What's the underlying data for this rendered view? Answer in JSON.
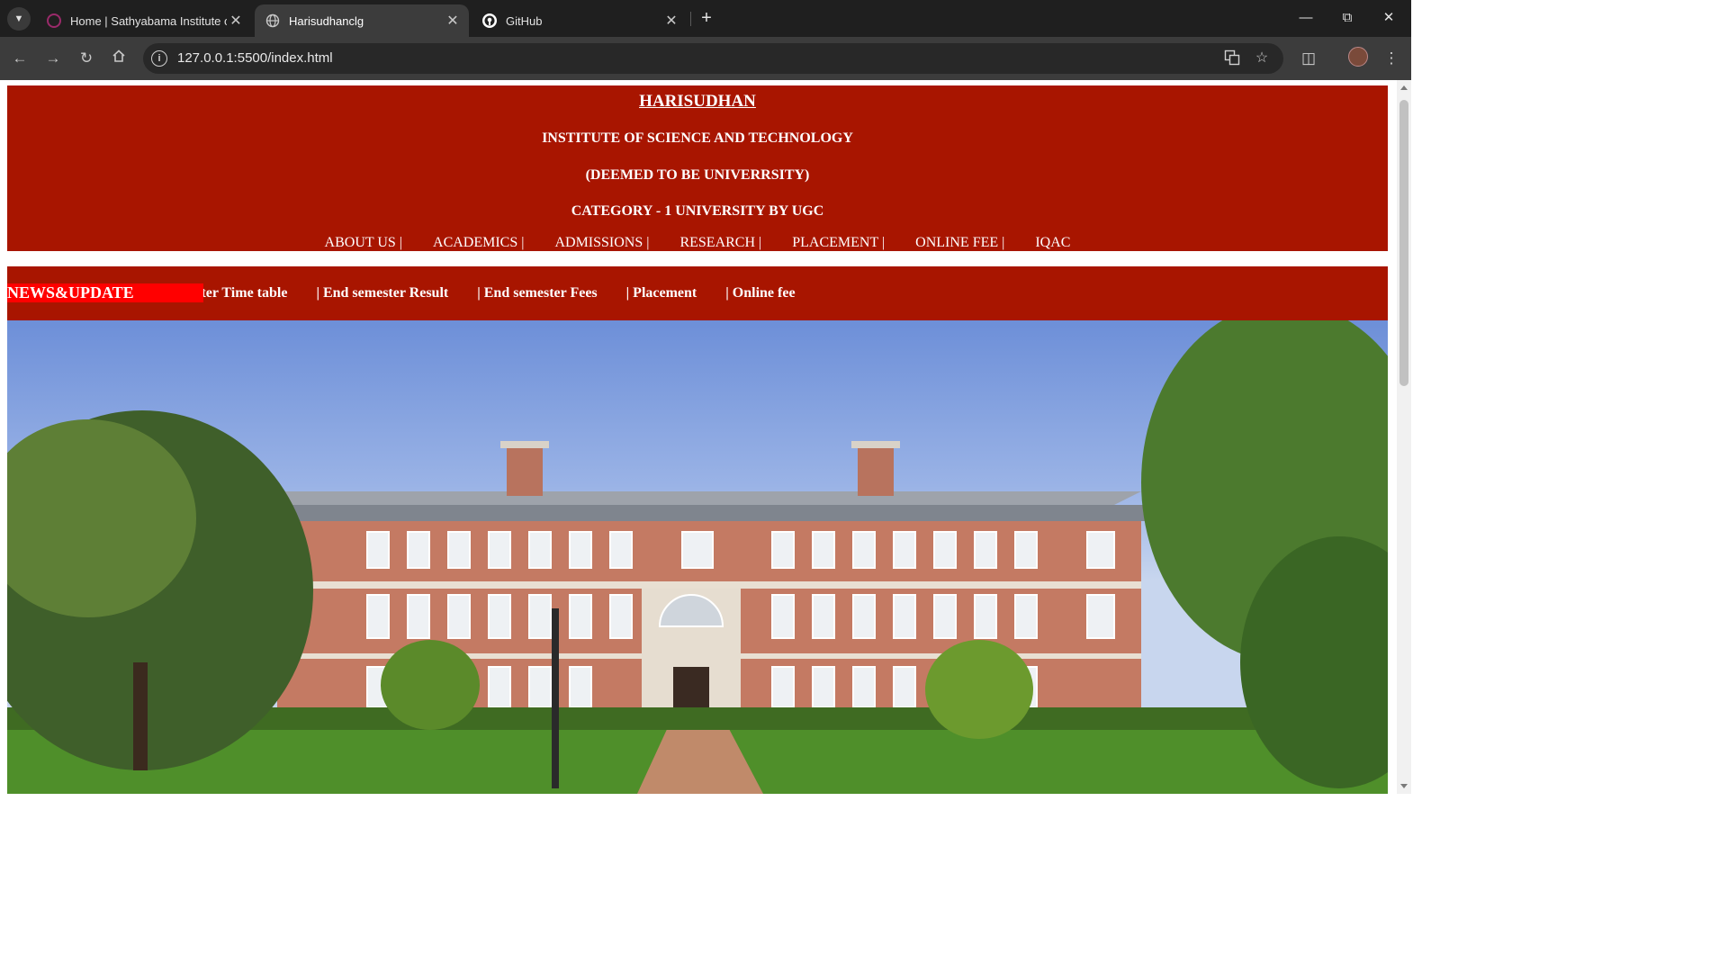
{
  "browser": {
    "tabs": [
      {
        "title": "Home | Sathyabama Institute of",
        "favicon": "sathyabama-favicon",
        "active": false
      },
      {
        "title": "Harisudhanclg",
        "favicon": "globe-icon",
        "active": true
      },
      {
        "title": "GitHub",
        "favicon": "github-icon",
        "active": false
      }
    ],
    "url": "127.0.0.1:5500/index.html"
  },
  "page": {
    "header": {
      "name": "HARISUDHAN",
      "line1": "INSTITUTE OF SCIENCE AND TECHNOLOGY",
      "line2": "(DEEMED TO BE UNIVERRSITY)",
      "line3": "CATEGORY - 1 UNIVERSITY BY UGC"
    },
    "nav": {
      "about": "ABOUT US |",
      "academics": "ACADEMICS |",
      "admissions": "ADMISSIONS |",
      "research": "RESEARCH |",
      "placement": "PLACEMENT |",
      "online_fee": "ONLINE FEE |",
      "iqac": "IQAC"
    },
    "news": {
      "label": "NEWS&UPDATE",
      "items": {
        "timetable": "End semester Time table",
        "result": "| End semester Result",
        "fees": "| End semester Fees",
        "placement": "| Placement",
        "online_fee": "| Online fee"
      }
    },
    "hero_image": "college-building-photo"
  },
  "colors": {
    "header_bg": "#a81500",
    "news_label_bg": "#ff0000",
    "chrome_dark": "#1f1f1f",
    "chrome_toolbar": "#3c3c3c"
  }
}
